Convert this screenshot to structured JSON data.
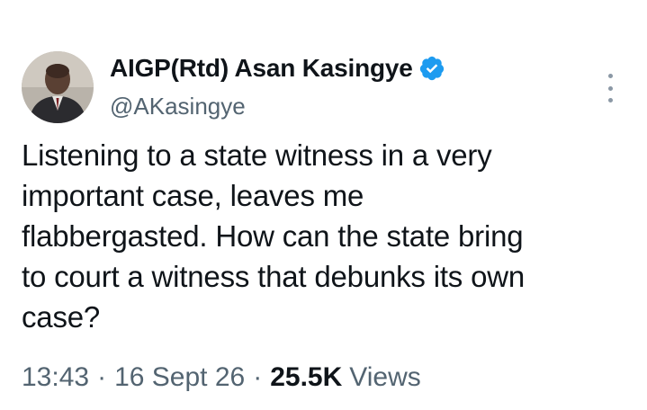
{
  "tweet": {
    "author": {
      "display_name": "AIGP(Rtd) Asan Kasingye",
      "handle": "@AKasingye",
      "verified": true,
      "verified_icon": "verified-badge-icon"
    },
    "text_lines": [
      "Listening to a state witness in a very",
      "important case, leaves me",
      "flabbergasted. How can the state bring",
      "to court a witness that debunks its own",
      "case?"
    ],
    "meta": {
      "time": "13:43",
      "separator": "·",
      "date": "16 Sept 26",
      "views_count": "25.5K",
      "views_label": "Views"
    },
    "more_icon": "more-options-icon"
  },
  "colors": {
    "primary_text": "#0f1419",
    "secondary_text": "#536471",
    "verified_blue": "#1d9bf0",
    "background": "#ffffff"
  }
}
